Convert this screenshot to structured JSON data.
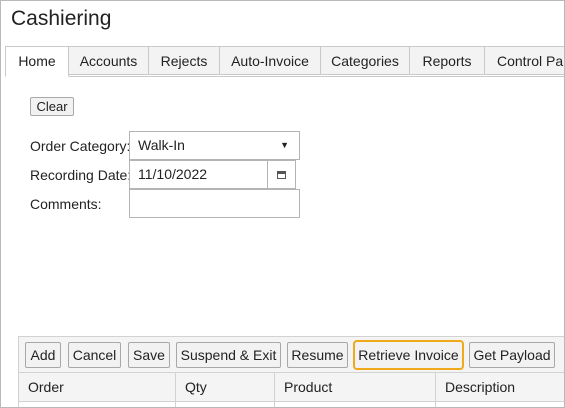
{
  "app": {
    "title": "Cashiering"
  },
  "tabs": [
    {
      "label": "Home",
      "active": true
    },
    {
      "label": "Accounts"
    },
    {
      "label": "Rejects"
    },
    {
      "label": "Auto-Invoice"
    },
    {
      "label": "Categories"
    },
    {
      "label": "Reports"
    },
    {
      "label": "Control Pan"
    }
  ],
  "form": {
    "clear_label": "Clear",
    "order_category": {
      "label": "Order Category:",
      "value": "Walk-In"
    },
    "recording_date": {
      "label": "Recording Date:",
      "value": "11/10/2022"
    },
    "comments": {
      "label": "Comments:",
      "value": ""
    }
  },
  "toolbar": {
    "buttons": [
      "Add",
      "Cancel",
      "Save",
      "Suspend & Exit",
      "Resume",
      "Retrieve Invoice",
      "Get Payload"
    ],
    "highlighted": "Retrieve Invoice",
    "highlight_color": "#f0a91a"
  },
  "grid": {
    "columns": [
      "Order",
      "Qty",
      "Product",
      "Description"
    ]
  }
}
